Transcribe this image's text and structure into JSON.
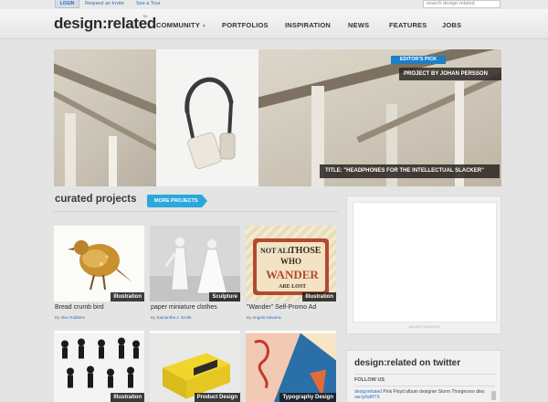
{
  "topbar": {
    "login_label": "LOGIN",
    "request_invite": "Request an Invite",
    "tour": "See a Tour",
    "search_placeholder": "search design:related"
  },
  "header": {
    "logo": "design:related",
    "logo_tm": "TM",
    "nav": [
      "COMMUNITY",
      "PORTFOLIOS",
      "INSPIRATION",
      "NEWS",
      "FEATURES",
      "JOBS"
    ]
  },
  "hero": {
    "badge": "EDITOR'S PICK",
    "credit": "PROJECT BY JOHAN PERSSON",
    "title": "TITLE: \"HEADPHONES FOR THE INTELLECTUAL SLACKER\""
  },
  "curated": {
    "heading": "curated projects",
    "more_label": "MORE PROJECTS",
    "by_label": "By",
    "cards": [
      {
        "tag": "Illustration",
        "title": "Bread crumb bird",
        "author": "Alex Robbins"
      },
      {
        "tag": "Sculpture",
        "title": "paper miniature clothes",
        "author": "Samantha J. Smith"
      },
      {
        "tag": "Illustration",
        "title": "\"Wander\" Self-Promo Ad",
        "author": "Angela Navarra"
      },
      {
        "tag": "Illustration",
        "title": "",
        "author": ""
      },
      {
        "tag": "Product Design",
        "title": "",
        "author": ""
      },
      {
        "tag": "Typography Design",
        "title": "",
        "author": ""
      }
    ],
    "poster_lines": [
      "NOT ALL",
      "THOSE",
      "WHO",
      "WANDER",
      "ARE LOST"
    ]
  },
  "sidebar": {
    "ad_label": "ADVERTISEMENT",
    "twitter_heading": "design:related on twitter",
    "follow_label": "FOLLOW US",
    "tweet_user": "designrelated",
    "tweet_text": "Pink Floyd album designer Storm Thorgerson dies",
    "tweet_link": "ow.ly/kdHTX"
  },
  "colors": {
    "accent_blue": "#2aa8dc",
    "link_blue": "#2e6cb8",
    "badge_blue": "#1e7fc6"
  }
}
